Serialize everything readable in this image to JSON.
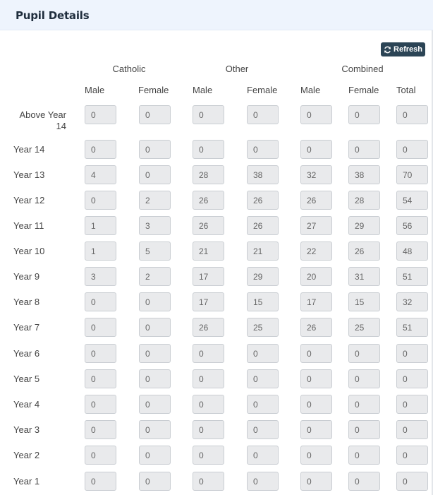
{
  "panel": {
    "title": "Pupil Details"
  },
  "refresh": {
    "label": "Refresh"
  },
  "groups": [
    "Catholic",
    "Other",
    "Combined"
  ],
  "columns": [
    "Male",
    "Female",
    "Male",
    "Female",
    "Male",
    "Female",
    "Total"
  ],
  "rows": [
    {
      "label": "Above Year 14",
      "values": [
        "0",
        "0",
        "0",
        "0",
        "0",
        "0",
        "0"
      ]
    },
    {
      "label": "Year 14",
      "values": [
        "0",
        "0",
        "0",
        "0",
        "0",
        "0",
        "0"
      ]
    },
    {
      "label": "Year 13",
      "values": [
        "4",
        "0",
        "28",
        "38",
        "32",
        "38",
        "70"
      ]
    },
    {
      "label": "Year 12",
      "values": [
        "0",
        "2",
        "26",
        "26",
        "26",
        "28",
        "54"
      ]
    },
    {
      "label": "Year 11",
      "values": [
        "1",
        "3",
        "26",
        "26",
        "27",
        "29",
        "56"
      ]
    },
    {
      "label": "Year 10",
      "values": [
        "1",
        "5",
        "21",
        "21",
        "22",
        "26",
        "48"
      ]
    },
    {
      "label": "Year 9",
      "values": [
        "3",
        "2",
        "17",
        "29",
        "20",
        "31",
        "51"
      ]
    },
    {
      "label": "Year 8",
      "values": [
        "0",
        "0",
        "17",
        "15",
        "17",
        "15",
        "32"
      ]
    },
    {
      "label": "Year 7",
      "values": [
        "0",
        "0",
        "26",
        "25",
        "26",
        "25",
        "51"
      ]
    },
    {
      "label": "Year 6",
      "values": [
        "0",
        "0",
        "0",
        "0",
        "0",
        "0",
        "0"
      ]
    },
    {
      "label": "Year 5",
      "values": [
        "0",
        "0",
        "0",
        "0",
        "0",
        "0",
        "0"
      ]
    },
    {
      "label": "Year 4",
      "values": [
        "0",
        "0",
        "0",
        "0",
        "0",
        "0",
        "0"
      ]
    },
    {
      "label": "Year 3",
      "values": [
        "0",
        "0",
        "0",
        "0",
        "0",
        "0",
        "0"
      ]
    },
    {
      "label": "Year 2",
      "values": [
        "0",
        "0",
        "0",
        "0",
        "0",
        "0",
        "0"
      ]
    },
    {
      "label": "Year 1",
      "values": [
        "0",
        "0",
        "0",
        "0",
        "0",
        "0",
        "0"
      ]
    }
  ],
  "icons": {
    "refresh": "refresh-icon"
  },
  "colors": {
    "header_bg": "#eef4fd",
    "button_bg": "#2b4455",
    "field_bg": "#e9eaec"
  }
}
